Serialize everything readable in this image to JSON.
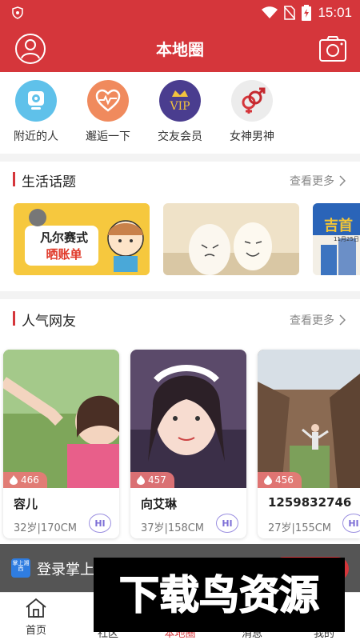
{
  "status_bar": {
    "time": "15:01"
  },
  "header": {
    "title": "本地圈"
  },
  "quick_actions": [
    {
      "label": "附近的人",
      "icon": "location-pin-icon",
      "color": "#5fc1ea"
    },
    {
      "label": "邂逅一下",
      "icon": "heartbeat-icon",
      "color": "#f08a5d"
    },
    {
      "label": "交友会员",
      "icon": "vip-crown-icon",
      "color": "#4a3d8f"
    },
    {
      "label": "女神男神",
      "icon": "gender-symbols-icon",
      "color": "#ececec"
    }
  ],
  "life_topics": {
    "title": "生活话题",
    "more": "查看更多",
    "card1_text_line1": "凡尔赛式",
    "card1_text_line2": "晒账单",
    "card3_text": "吉首",
    "card3_sub": "11月25日"
  },
  "popular_friends": {
    "title": "人气网友",
    "more": "查看更多",
    "cards": [
      {
        "name": "容儿",
        "likes": "466",
        "info": "32岁|170CM",
        "hi": "HI"
      },
      {
        "name": "向艾琳",
        "likes": "457",
        "info": "37岁|158CM",
        "hi": "HI"
      },
      {
        "name": "1259832746",
        "likes": "456",
        "info": "27岁|155CM",
        "hi": "HI"
      }
    ]
  },
  "login_banner": {
    "text": "登录掌上",
    "logo_text": "掌上湘西"
  },
  "bottom_nav": [
    {
      "label": "首页"
    },
    {
      "label": "社区"
    },
    {
      "label": "本地圈"
    },
    {
      "label": "消息"
    },
    {
      "label": "我的"
    }
  ],
  "watermark": {
    "text": "下载鸟资源"
  },
  "colors": {
    "brand_red": "#d5363b",
    "hi_purple": "#7d6fd6"
  }
}
